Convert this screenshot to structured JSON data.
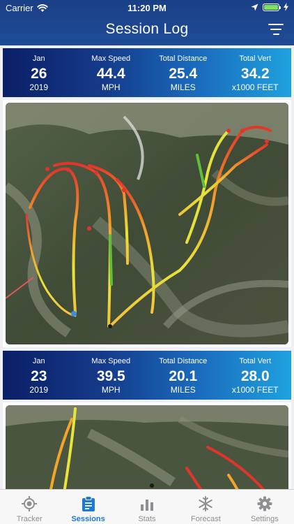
{
  "status": {
    "carrier": "Carrier",
    "time": "11:20 PM"
  },
  "nav": {
    "title": "Session Log"
  },
  "sessions": [
    {
      "month": "Jan",
      "day": "26",
      "year": "2019",
      "max_speed_label": "Max Speed",
      "max_speed": "44.4",
      "max_speed_unit": "MPH",
      "distance_label": "Total Distance",
      "distance": "25.4",
      "distance_unit": "MILES",
      "vert_label": "Total Vert",
      "vert": "34.2",
      "vert_unit": "x1000 FEET"
    },
    {
      "month": "Jan",
      "day": "23",
      "year": "2019",
      "max_speed_label": "Max Speed",
      "max_speed": "39.5",
      "max_speed_unit": "MPH",
      "distance_label": "Total Distance",
      "distance": "20.1",
      "distance_unit": "MILES",
      "vert_label": "Total Vert",
      "vert": "28.0",
      "vert_unit": "x1000 FEET"
    }
  ],
  "tabs": [
    {
      "label": "Tracker",
      "icon": "crosshair-icon"
    },
    {
      "label": "Sessions",
      "icon": "clipboard-icon",
      "active": true
    },
    {
      "label": "Stats",
      "icon": "bar-chart-icon"
    },
    {
      "label": "Forecast",
      "icon": "snowflake-icon"
    },
    {
      "label": "Settings",
      "icon": "gear-icon"
    }
  ],
  "colors": {
    "header": "#1a3f86",
    "active_tab": "#1f78d1",
    "inactive_tab": "#8e8e93"
  }
}
